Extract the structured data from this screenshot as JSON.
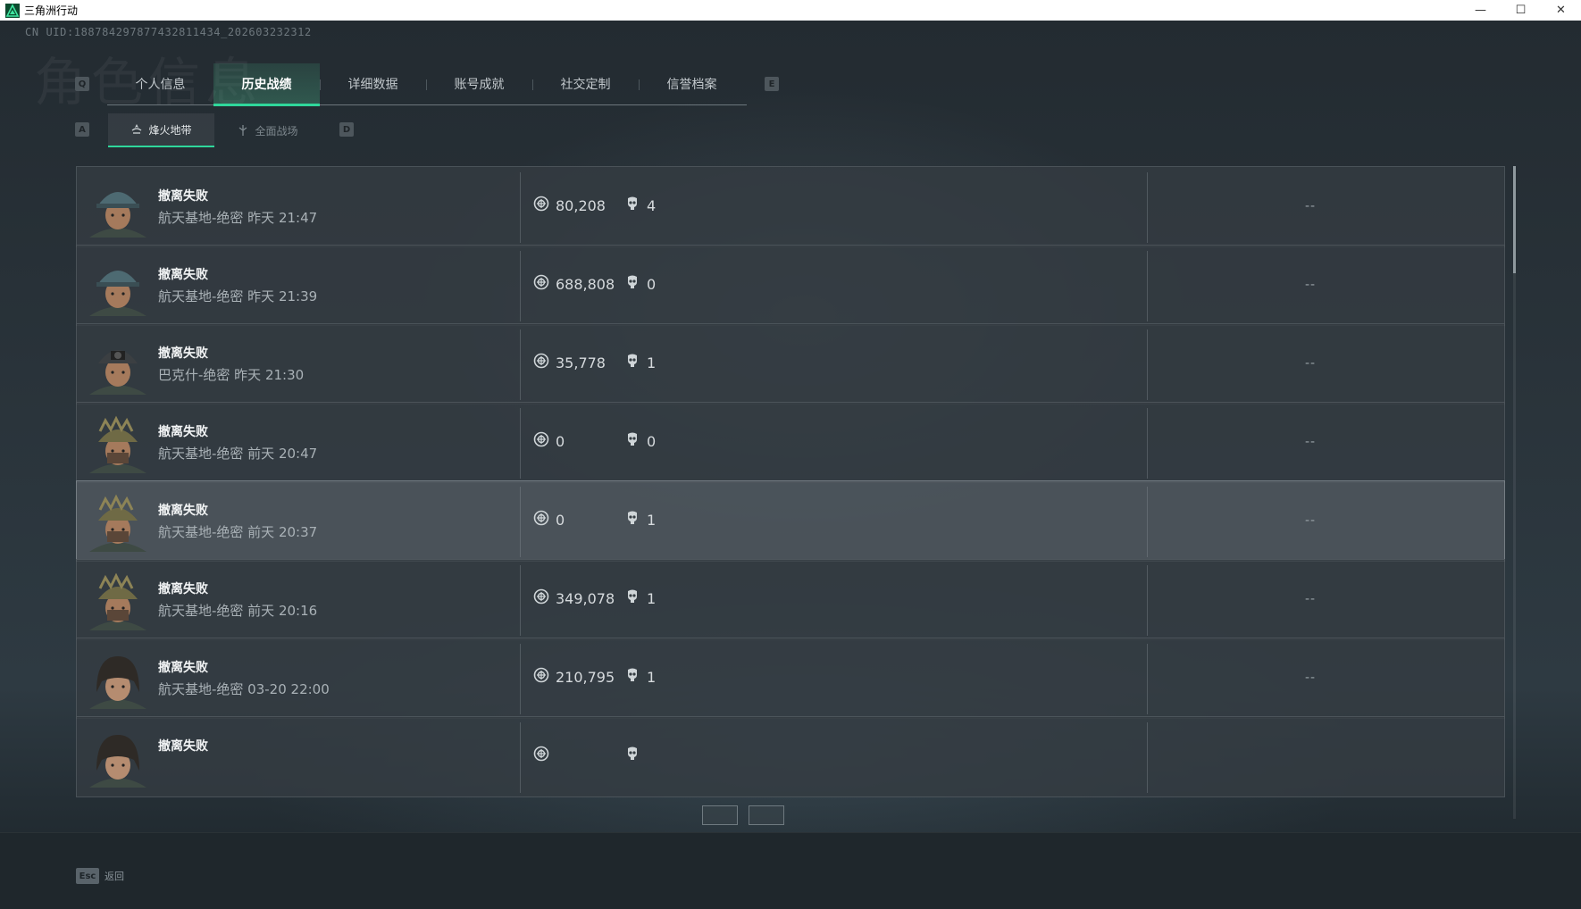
{
  "window": {
    "title": "三角洲行动",
    "minimize": "—",
    "maximize": "☐",
    "close": "✕"
  },
  "uid": "CN UID:18878429787743281143​4_202603232312",
  "watermark": "角色信息",
  "key_hints": {
    "prev_tab": "Q",
    "next_tab": "E",
    "prev_sub": "A",
    "next_sub": "D"
  },
  "tabs": [
    {
      "label": "个人信息",
      "active": false
    },
    {
      "label": "历史战绩",
      "active": true
    },
    {
      "label": "详细数据",
      "active": false
    },
    {
      "label": "账号成就",
      "active": false
    },
    {
      "label": "社交定制",
      "active": false
    },
    {
      "label": "信誉档案",
      "active": false
    }
  ],
  "subtabs": [
    {
      "label": "烽火地带",
      "icon": "fire-zone-icon",
      "active": true
    },
    {
      "label": "全面战场",
      "icon": "battlefield-icon",
      "active": false
    }
  ],
  "records": [
    {
      "status": "撤离失败",
      "match": "航天基地-绝密 昨天 21:47",
      "value": "80,208",
      "kills": "4",
      "result": "--",
      "avatar": "operator-cap",
      "highlight": false
    },
    {
      "status": "撤离失败",
      "match": "航天基地-绝密 昨天 21:39",
      "value": "688,808",
      "kills": "0",
      "result": "--",
      "avatar": "operator-cap",
      "highlight": false
    },
    {
      "status": "撤离失败",
      "match": "巴克什-绝密 昨天 21:30",
      "value": "35,778",
      "kills": "1",
      "result": "--",
      "avatar": "operator-nightvision",
      "highlight": false
    },
    {
      "status": "撤离失败",
      "match": "航天基地-绝密 前天 20:47",
      "value": "0",
      "kills": "0",
      "result": "--",
      "avatar": "operator-camo",
      "highlight": false
    },
    {
      "status": "撤离失败",
      "match": "航天基地-绝密 前天 20:37",
      "value": "0",
      "kills": "1",
      "result": "--",
      "avatar": "operator-camo",
      "highlight": true
    },
    {
      "status": "撤离失败",
      "match": "航天基地-绝密 前天 20:16",
      "value": "349,078",
      "kills": "1",
      "result": "--",
      "avatar": "operator-camo",
      "highlight": false
    },
    {
      "status": "撤离失败",
      "match": "航天基地-绝密 03-20 22:00",
      "value": "210,795",
      "kills": "1",
      "result": "--",
      "avatar": "operator-female",
      "highlight": false
    },
    {
      "status": "撤离失败",
      "match": "",
      "value": "",
      "kills": "",
      "result": "",
      "avatar": "operator-female",
      "highlight": false
    }
  ],
  "footer": {
    "esc_key": "Esc",
    "back_label": "返回"
  },
  "colors": {
    "accent": "#2fd79b",
    "row_bg": "#343c42",
    "text_primary": "#f2f4f5",
    "text_secondary": "#a9b1b6"
  }
}
